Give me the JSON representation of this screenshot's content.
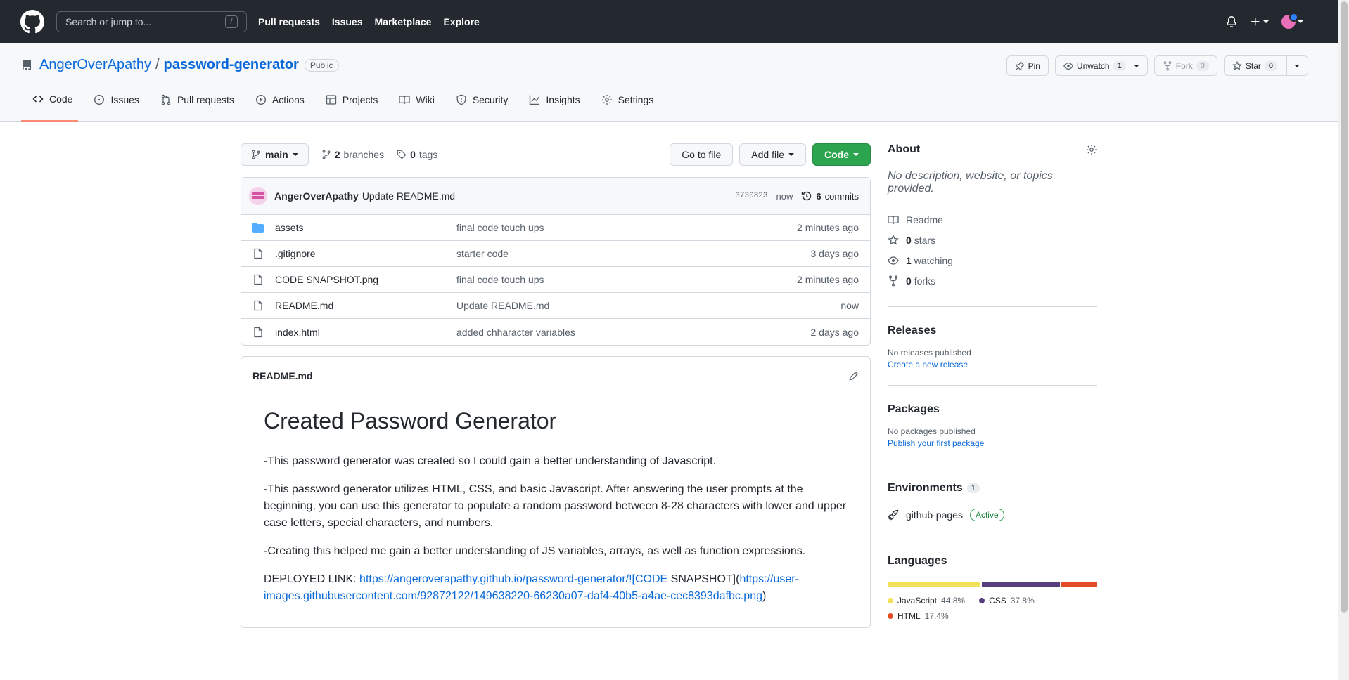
{
  "header": {
    "search_placeholder": "Search or jump to...",
    "search_shortcut": "/",
    "nav": [
      "Pull requests",
      "Issues",
      "Marketplace",
      "Explore"
    ]
  },
  "repo": {
    "owner": "AngerOverApathy",
    "separator": "/",
    "name": "password-generator",
    "visibility": "Public",
    "actions": {
      "pin": "Pin",
      "unwatch": "Unwatch",
      "watch_count": "1",
      "fork": "Fork",
      "fork_count": "0",
      "star": "Star",
      "star_count": "0"
    },
    "tabs": [
      "Code",
      "Issues",
      "Pull requests",
      "Actions",
      "Projects",
      "Wiki",
      "Security",
      "Insights",
      "Settings"
    ]
  },
  "filebar": {
    "branch": "main",
    "branches_count": "2",
    "branches_label": "branches",
    "tags_count": "0",
    "tags_label": "tags",
    "go_to_file": "Go to file",
    "add_file": "Add file",
    "code": "Code"
  },
  "commit": {
    "author": "AngerOverApathy",
    "message": "Update README.md",
    "sha": "3730823",
    "age": "now",
    "commits_count": "6",
    "commits_label": "commits"
  },
  "files": [
    {
      "type": "folder",
      "name": "assets",
      "message": "final code touch ups",
      "age": "2 minutes ago"
    },
    {
      "type": "file",
      "name": ".gitignore",
      "message": "starter code",
      "age": "3 days ago"
    },
    {
      "type": "file",
      "name": "CODE SNAPSHOT.png",
      "message": "final code touch ups",
      "age": "2 minutes ago"
    },
    {
      "type": "file",
      "name": "README.md",
      "message": "Update README.md",
      "age": "now"
    },
    {
      "type": "file",
      "name": "index.html",
      "message": "added chharacter variables",
      "age": "2 days ago"
    }
  ],
  "readme": {
    "filename": "README.md",
    "title": "Created Password Generator",
    "p1": "-This password generator was created so I could gain a better understanding of Javascript.",
    "p2": "-This password generator utilizes HTML, CSS, and basic Javascript. After answering the user prompts at the beginning, you can use this generator to populate a random password between 8-28 characters with lower and upper case letters, special characters, and numbers.",
    "p3": "-Creating this helped me gain a better understanding of JS variables, arrays, as well as function expressions.",
    "deployed_prefix": "DEPLOYED LINK: ",
    "deployed_link": "https://angeroverapathy.github.io/password-generator/![CODE",
    "deployed_mid": " SNAPSHOT](",
    "snapshot_link": "https://user-images.githubusercontent.com/92872122/149638220-66230a07-daf4-40b5-a4ae-cec8393dafbc.png",
    "deployed_suffix": ")"
  },
  "about": {
    "title": "About",
    "description": "No description, website, or topics provided.",
    "readme": "Readme",
    "stars_count": "0",
    "stars_label": "stars",
    "watching_count": "1",
    "watching_label": "watching",
    "forks_count": "0",
    "forks_label": "forks"
  },
  "releases": {
    "title": "Releases",
    "empty": "No releases published",
    "link": "Create a new release"
  },
  "packages": {
    "title": "Packages",
    "empty": "No packages published",
    "link": "Publish your first package"
  },
  "environments": {
    "title": "Environments",
    "count": "1",
    "name": "github-pages",
    "status": "Active"
  },
  "languages": {
    "title": "Languages",
    "items": [
      {
        "name": "JavaScript",
        "percent": "44.8%",
        "value": 44.8,
        "color": "#f1e05a"
      },
      {
        "name": "CSS",
        "percent": "37.8%",
        "value": 37.8,
        "color": "#563d7c"
      },
      {
        "name": "HTML",
        "percent": "17.4%",
        "value": 17.4,
        "color": "#e34c26"
      }
    ]
  }
}
